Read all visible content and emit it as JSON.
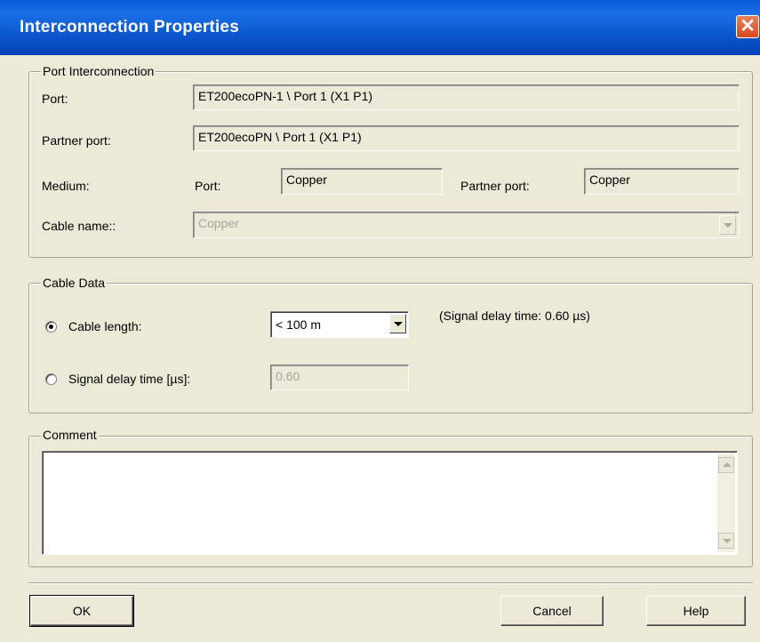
{
  "window": {
    "title": "Interconnection Properties",
    "close_glyph": "✕"
  },
  "port_interconnection": {
    "legend": "Port Interconnection",
    "port_label": "Port:",
    "port_value": "ET200ecoPN-1 \\ Port 1 (X1 P1)",
    "partner_port_label": "Partner port:",
    "partner_port_value": "ET200ecoPN \\ Port 1 (X1 P1)",
    "medium_label": "Medium:",
    "medium_port_label": "Port:",
    "medium_port_value": "Copper",
    "medium_partner_label": "Partner port:",
    "medium_partner_value": "Copper",
    "cable_name_label": "Cable name::",
    "cable_name_value": "Copper"
  },
  "cable_data": {
    "legend": "Cable Data",
    "cable_length_label": "Cable length:",
    "cable_length_value": "< 100 m",
    "cable_length_selected": true,
    "signal_delay_note": "(Signal delay time: 0.60 µs)",
    "signal_delay_label": "Signal delay time [µs]:",
    "signal_delay_value": "0.60",
    "signal_delay_selected": false
  },
  "comment": {
    "legend": "Comment",
    "value": ""
  },
  "buttons": {
    "ok": "OK",
    "cancel": "Cancel",
    "help": "Help"
  }
}
